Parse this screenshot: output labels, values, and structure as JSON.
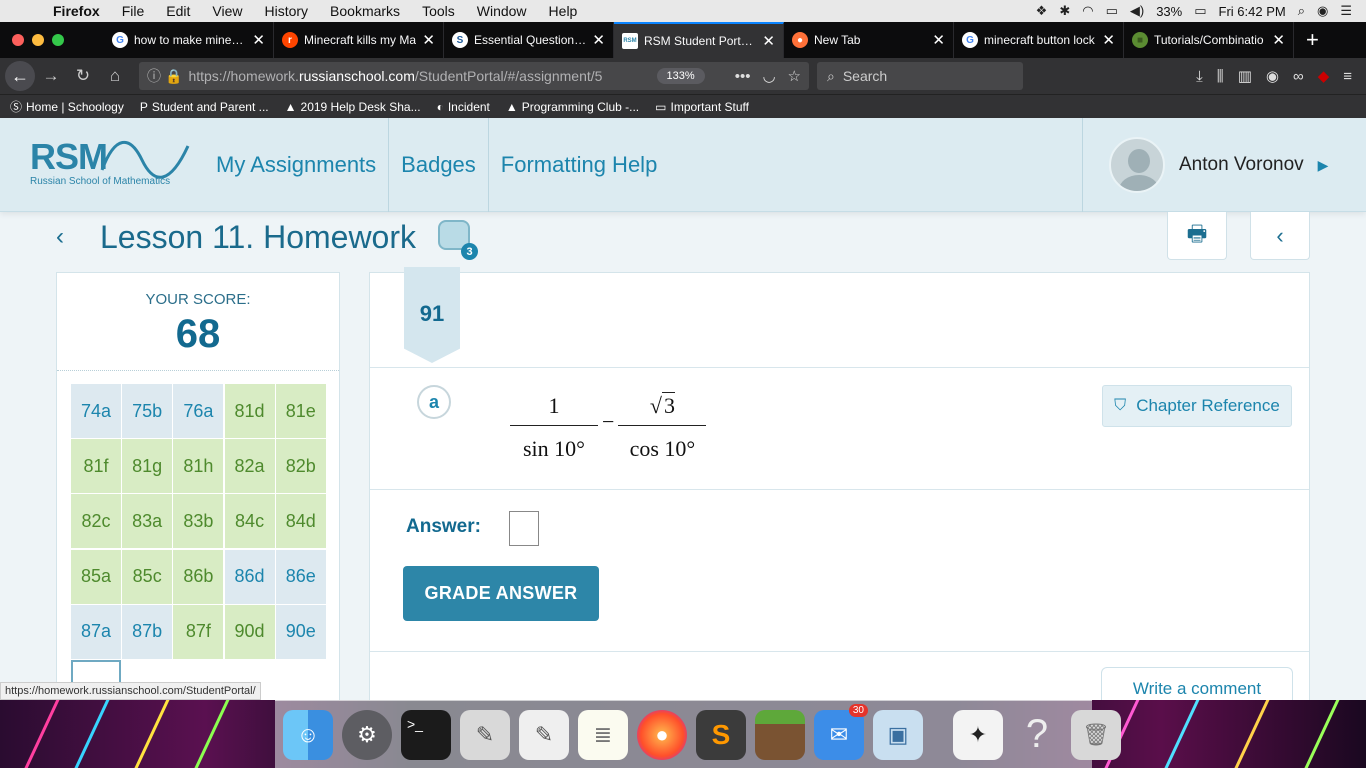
{
  "menubar": {
    "app_name": "Firefox",
    "menus": [
      "File",
      "Edit",
      "View",
      "History",
      "Bookmarks",
      "Tools",
      "Window",
      "Help"
    ],
    "battery": "33%",
    "clock": "Fri 6:42 PM"
  },
  "tabs": [
    {
      "title": "how to make minecra",
      "fav": "G",
      "fav_color": "#ffffff",
      "fav_text": "#4285f4"
    },
    {
      "title": "Minecraft kills my Ma",
      "fav": "r",
      "fav_color": "#ff4500",
      "fav_text": "#ffffff"
    },
    {
      "title": "Essential Question: S",
      "fav": "S",
      "fav_color": "#ffffff",
      "fav_text": "#1e5b9b"
    },
    {
      "title": "RSM Student Portal -",
      "fav": "RSM",
      "fav_color": "#ffffff",
      "fav_text": "#2b84a8",
      "active": true
    },
    {
      "title": "New Tab",
      "fav": "●",
      "fav_color": "#ff7139",
      "fav_text": "#ffffff"
    },
    {
      "title": "minecraft button lock",
      "fav": "G",
      "fav_color": "#ffffff",
      "fav_text": "#4285f4"
    },
    {
      "title": "Tutorials/Combinatio",
      "fav": "■",
      "fav_color": "#5b8c32",
      "fav_text": "#3a5a1f"
    }
  ],
  "navbar": {
    "url_prefix": "https://homework.",
    "url_domain": "russianschool.com",
    "url_path": "/StudentPortal/#/assignment/5",
    "zoom": "133%",
    "search_placeholder": "Search"
  },
  "bookmarks": [
    {
      "label": "Home | Schoology",
      "icon": "Ⓢ"
    },
    {
      "label": "Student and Parent ...",
      "icon": "P"
    },
    {
      "label": "2019 Help Desk Sha...",
      "icon": "▲"
    },
    {
      "label": "Incident",
      "icon": "◐"
    },
    {
      "label": "Programming Club -...",
      "icon": "▲"
    },
    {
      "label": "Important Stuff",
      "icon": "▭"
    }
  ],
  "header": {
    "logo_text": "RSM",
    "logo_tagline": "Russian School of Mathematics",
    "nav": [
      "My Assignments",
      "Badges",
      "Formatting Help"
    ],
    "user_name": "Anton Voronov"
  },
  "lesson": {
    "title": "Lesson 11. Homework",
    "badge_count": "3"
  },
  "score": {
    "label": "YOUR SCORE:",
    "value": "68",
    "cells": [
      {
        "label": "74a",
        "status": "blue"
      },
      {
        "label": "75b",
        "status": "blue"
      },
      {
        "label": "76a",
        "status": "blue"
      },
      {
        "label": "81d",
        "status": "green"
      },
      {
        "label": "81e",
        "status": "green"
      },
      {
        "label": "81f",
        "status": "green"
      },
      {
        "label": "81g",
        "status": "green"
      },
      {
        "label": "81h",
        "status": "green"
      },
      {
        "label": "82a",
        "status": "green"
      },
      {
        "label": "82b",
        "status": "green"
      },
      {
        "label": "82c",
        "status": "green"
      },
      {
        "label": "83a",
        "status": "green"
      },
      {
        "label": "83b",
        "status": "green"
      },
      {
        "label": "84c",
        "status": "green"
      },
      {
        "label": "84d",
        "status": "green"
      },
      {
        "label": "85a",
        "status": "green"
      },
      {
        "label": "85c",
        "status": "green"
      },
      {
        "label": "86b",
        "status": "green"
      },
      {
        "label": "86d",
        "status": "blue"
      },
      {
        "label": "86e",
        "status": "blue"
      },
      {
        "label": "87a",
        "status": "blue"
      },
      {
        "label": "87b",
        "status": "blue"
      },
      {
        "label": "87f",
        "status": "green"
      },
      {
        "label": "90d",
        "status": "green"
      },
      {
        "label": "90e",
        "status": "blue"
      },
      {
        "label": "",
        "status": "selected"
      }
    ]
  },
  "problem": {
    "number": "91",
    "part": "a",
    "frac1_num": "1",
    "frac1_den": "sin 10°",
    "minus": "−",
    "frac2_num_root": "√",
    "frac2_num": "3",
    "frac2_den": "cos 10°",
    "chapter_ref": "Chapter Reference",
    "answer_label": "Answer:",
    "grade_button": "GRADE ANSWER",
    "comment_button": "Write a comment"
  },
  "status_url": "https://homework.russianschool.com/StudentPortal/",
  "dock": {
    "mail_badge": "30",
    "icons": [
      "finder-icon",
      "system-preferences-icon",
      "terminal-icon",
      "script-editor-icon",
      "textedit-icon",
      "notes-icon",
      "firefox-icon",
      "sublime-text-icon",
      "minecraft-icon",
      "mail-icon",
      "preview-icon",
      "grapher-icon",
      "help-icon",
      "trash-icon"
    ]
  },
  "colors": {
    "brand": "#2b84a8",
    "score_blue": "#1c85ad",
    "score_green": "#4e8a2d"
  }
}
